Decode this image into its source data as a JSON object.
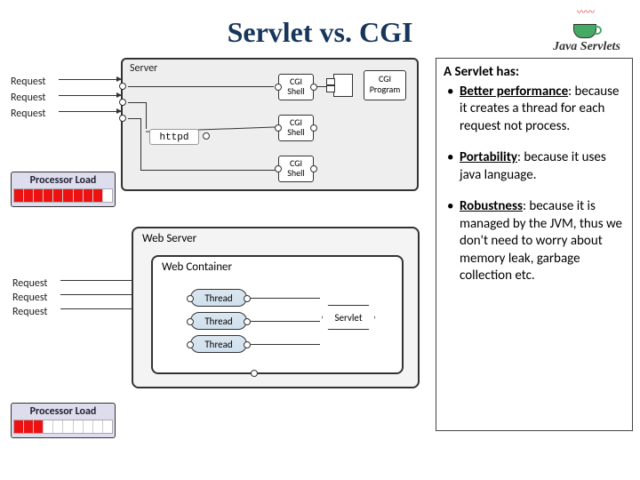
{
  "title": "Servlet vs. CGI",
  "logo": {
    "text": "Java Servlets",
    "icon": "java-cup-icon"
  },
  "diagram1": {
    "server_label": "Server",
    "requests": [
      "Request",
      "Request",
      "Request"
    ],
    "httpd": "httpd",
    "cgi_shell": "CGI\nShell",
    "cgi_program": "CGI\nProgram"
  },
  "diagram2": {
    "webserver_label": "Web Server",
    "webcontainer_label": "Web Container",
    "requests": [
      "Request",
      "Request",
      "Request"
    ],
    "thread": "Thread",
    "servlet": "Servlet"
  },
  "load": {
    "label": "Processor Load",
    "bar1_filled": 9,
    "bar1_total": 10,
    "bar2_filled": 3,
    "bar2_total": 10
  },
  "panel": {
    "heading": "A Servlet has:",
    "items": [
      {
        "title": "Better performance",
        "body": ": because it creates a thread for each request not process."
      },
      {
        "title": "Portability",
        "body": ": because it uses java language."
      },
      {
        "title": "Robustness",
        "body": ": because it is managed by the JVM, thus we don't need to worry about memory leak, garbage collection etc."
      }
    ]
  }
}
